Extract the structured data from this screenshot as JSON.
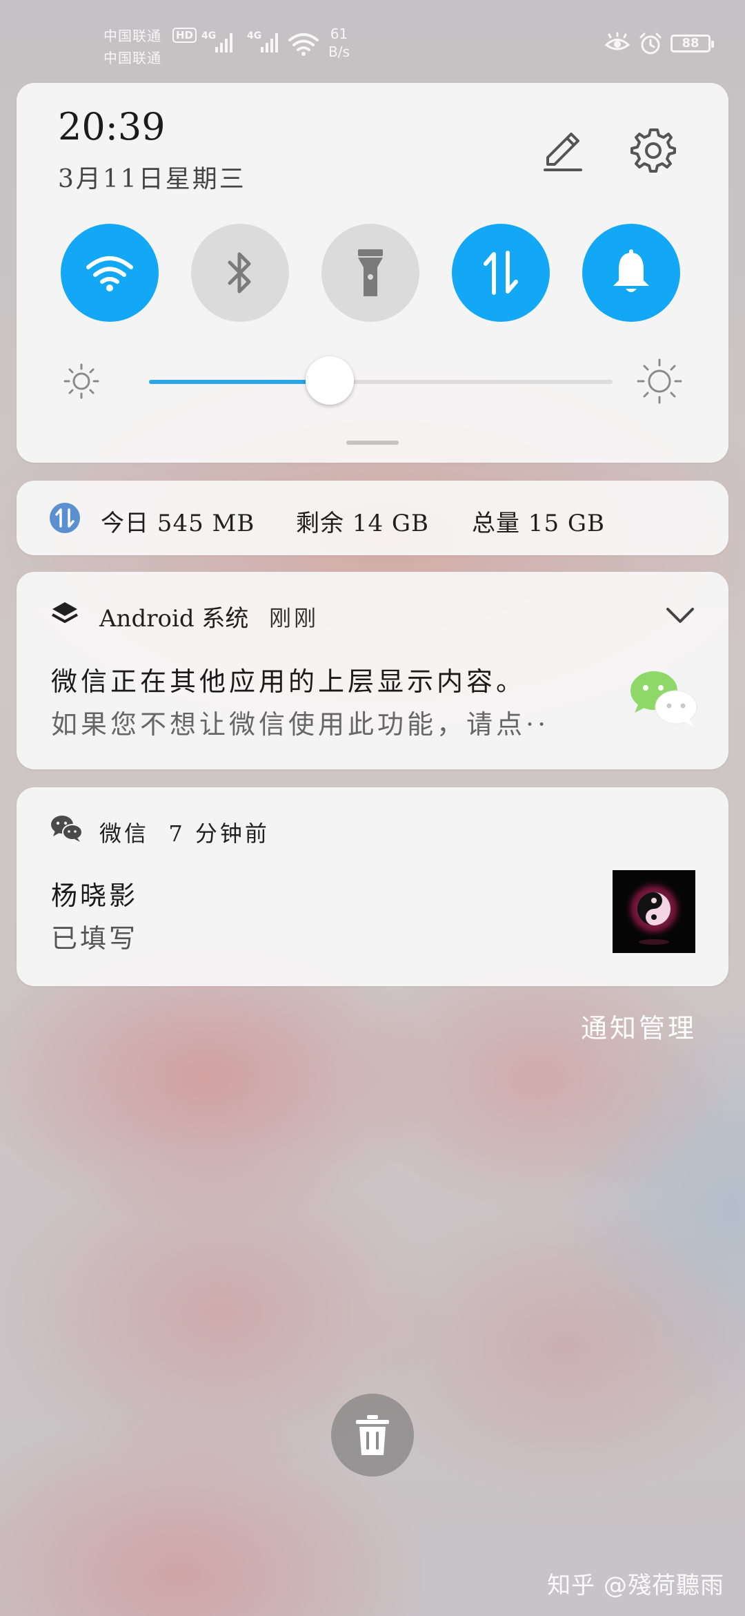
{
  "status_bar": {
    "carrier_1": "中国联通",
    "carrier_2": "中国联通",
    "hd": "HD",
    "net_1": "4G",
    "net_2": "4G",
    "speed_value": "61",
    "speed_unit": "B/s",
    "battery": "88",
    "icons": [
      "eye-icon",
      "alarm-icon",
      "battery-icon",
      "wifi-icon",
      "signal-icon"
    ]
  },
  "quick_settings": {
    "time": "20:39",
    "date": "3月11日星期三",
    "toggles": [
      {
        "id": "wifi",
        "icon": "wifi-icon",
        "on": true
      },
      {
        "id": "bluetooth",
        "icon": "bluetooth-icon",
        "on": false
      },
      {
        "id": "flashlight",
        "icon": "flashlight-icon",
        "on": false
      },
      {
        "id": "mobile-data",
        "icon": "mobile-data-icon",
        "on": true
      },
      {
        "id": "sound",
        "icon": "bell-icon",
        "on": true
      }
    ],
    "brightness_level": 0.39,
    "accent_color": "#12a8f5"
  },
  "data_usage": {
    "today": "今日 545 MB",
    "remaining": "剩余 14 GB",
    "total": "总量 15 GB"
  },
  "notifications": [
    {
      "app": "Android 系统",
      "time": "刚刚",
      "title": "微信正在其他应用的上层显示内容。",
      "body": "如果您不想让微信使用此功能，请点··"
    },
    {
      "app": "微信",
      "time": "7 分钟前",
      "title": "杨晓影",
      "body": "已填写"
    }
  ],
  "manage_label": "通知管理",
  "watermark": "知乎 @殘荷聽雨"
}
